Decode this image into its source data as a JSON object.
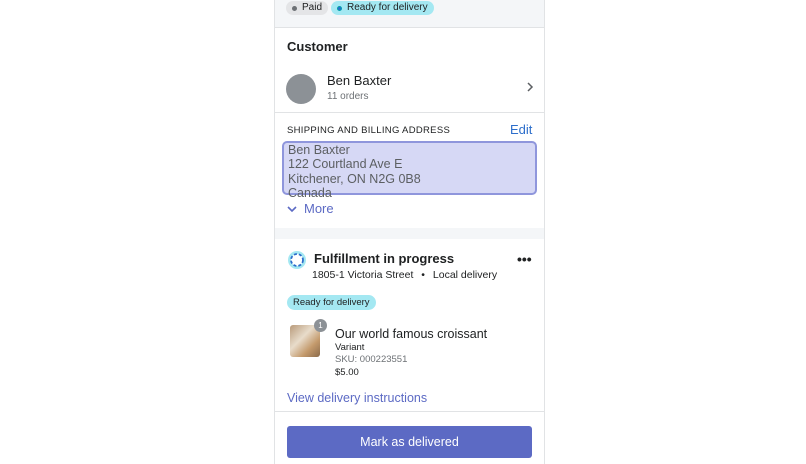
{
  "status": {
    "paid_label": "Paid",
    "ready_label": "Ready for delivery"
  },
  "customer": {
    "section_title": "Customer",
    "name": "Ben Baxter",
    "orders": "11 orders",
    "address_heading": "SHIPPING AND BILLING ADDRESS",
    "edit_label": "Edit",
    "address_lines": [
      "Ben Baxter",
      "122 Courtland Ave E",
      "Kitchener, ON N2G 0B8",
      "Canada"
    ],
    "more_label": "More"
  },
  "fulfillment": {
    "title": "Fulfillment in progress",
    "location": "1805-1 Victoria Street",
    "separator": "•",
    "method": "Local delivery",
    "more_icon": "more-horizontal-icon",
    "badge": "Ready for delivery",
    "item": {
      "quantity": "1",
      "name": "Our world famous croissant",
      "variant": "Variant",
      "sku": "SKU: 000223551",
      "price": "$5.00"
    },
    "instructions_link": "View delivery instructions",
    "primary_action": "Mark as delivered"
  },
  "colors": {
    "accent": "#5c6ac4",
    "badge_info": "#a4e8f2",
    "highlight": "#d6d8f5"
  }
}
